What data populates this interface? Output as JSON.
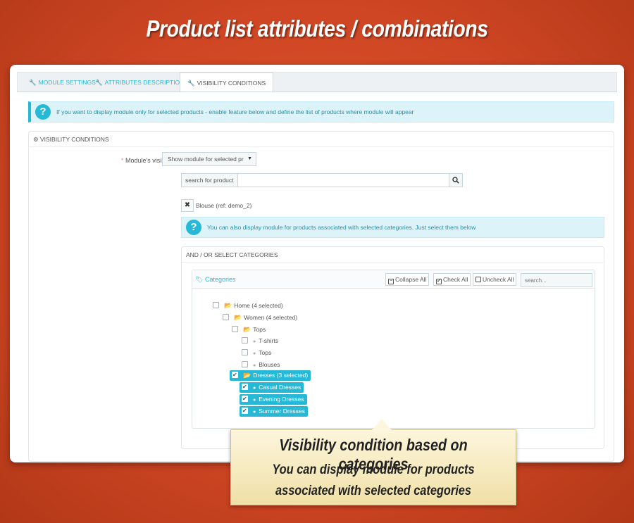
{
  "hero_title": "Product list attributes / combinations",
  "tabs": [
    {
      "label": "MODULE SETTINGS",
      "icon": "wrench-icon"
    },
    {
      "label": "ATTRIBUTES DESCRIPTIONS",
      "icon": "wrench-icon"
    },
    {
      "label": "VISIBILITY CONDITIONS",
      "icon": "wrench-icon",
      "active": true
    }
  ],
  "info_top": "If you want to display module only for selected products - enable feature below and define the list of products where module will appear",
  "section": {
    "title": "VISIBILITY CONDITIONS",
    "visibility_label": "Module's visibility",
    "required_mark": "*",
    "visibility_value": "Show module for selected pr",
    "search_addon": "search for product",
    "search_value": "",
    "selected_products": [
      "Blouse (ref: demo_2)"
    ],
    "info_categories": "You can also display module for products associated with selected categories. Just select them below"
  },
  "categories": {
    "section_title": "AND / OR SELECT CATEGORIES",
    "tree_title": "Categories",
    "collapse_all": "Collapse All",
    "check_all": "Check All",
    "uncheck_all": "Uncheck All",
    "search_placeholder": "search...",
    "nodes": [
      {
        "label": "Home (4 selected)",
        "type": "folder",
        "checked": false
      },
      {
        "label": "Women (4 selected)",
        "type": "folder",
        "checked": false
      },
      {
        "label": "Tops",
        "type": "folder",
        "checked": false
      },
      {
        "label": "T-shirts",
        "type": "leaf",
        "checked": false
      },
      {
        "label": "Tops",
        "type": "leaf",
        "checked": false
      },
      {
        "label": "Blouses",
        "type": "leaf",
        "checked": false
      },
      {
        "label": "Dresses (3 selected)",
        "type": "folder",
        "checked": true
      },
      {
        "label": "Casual Dresses",
        "type": "leaf",
        "checked": true
      },
      {
        "label": "Evening Dresses",
        "type": "leaf",
        "checked": true
      },
      {
        "label": "Summer Dresses",
        "type": "leaf",
        "checked": true
      }
    ]
  },
  "callout": {
    "title": "Visibility condition based on categories",
    "line1": "You can display module for products",
    "line2": "associated with selected categories"
  },
  "colors": {
    "accent": "#25b9d7",
    "background": "#d34a26",
    "info_bg": "#dcf4f9"
  }
}
